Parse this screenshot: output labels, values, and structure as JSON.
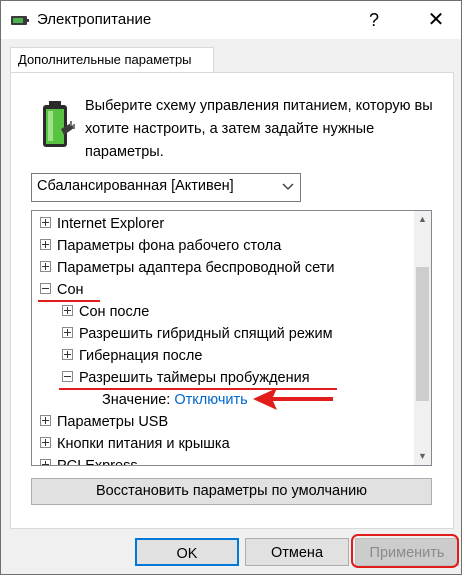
{
  "window": {
    "title": "Электропитание",
    "help_glyph": "?",
    "close_glyph": "✕"
  },
  "tab": {
    "label": "Дополнительные параметры"
  },
  "description": "Выберите схему управления питанием, которую вы хотите настроить, а затем задайте нужные параметры.",
  "plan_select": {
    "value": "Сбалансированная [Активен]"
  },
  "tree": {
    "items": [
      {
        "label": "Internet Explorer",
        "expanded": false,
        "level": 0
      },
      {
        "label": "Параметры фона рабочего стола",
        "expanded": false,
        "level": 0
      },
      {
        "label": "Параметры адаптера беспроводной сети",
        "expanded": false,
        "level": 0
      },
      {
        "label": "Сон",
        "expanded": true,
        "level": 0
      },
      {
        "label": "Сон после",
        "expanded": false,
        "level": 1
      },
      {
        "label": "Разрешить гибридный спящий режим",
        "expanded": false,
        "level": 1
      },
      {
        "label": "Гибернация после",
        "expanded": false,
        "level": 1
      },
      {
        "label": "Разрешить таймеры пробуждения",
        "expanded": true,
        "level": 1
      },
      {
        "label": "Параметры USB",
        "expanded": false,
        "level": 0
      },
      {
        "label": "Кнопки питания и крышка",
        "expanded": false,
        "level": 0
      },
      {
        "label": "PCI Express",
        "expanded": false,
        "level": 0
      }
    ],
    "value_label": "Значение:",
    "value_link": "Отключить"
  },
  "buttons": {
    "restore": "Восстановить параметры по умолчанию",
    "ok": "OK",
    "cancel": "Отмена",
    "apply": "Применить"
  },
  "colors": {
    "accent": "#0078d7",
    "highlight": "#e21b1b",
    "link": "#0066cc"
  }
}
